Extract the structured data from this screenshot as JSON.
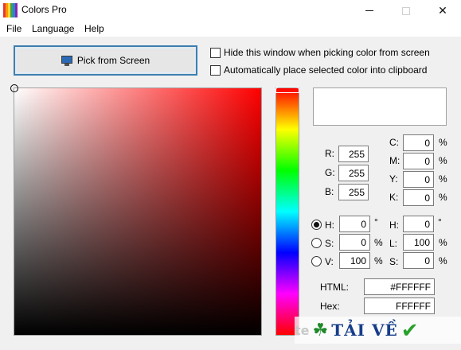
{
  "window": {
    "title": "Colors Pro",
    "icon": "color-bars-icon",
    "minimize_icon": "minimize-icon",
    "maximize_icon": "maximize-icon",
    "close_glyph": "✕"
  },
  "menu": {
    "items": [
      {
        "label": "File"
      },
      {
        "label": "Language"
      },
      {
        "label": "Help"
      }
    ]
  },
  "toolbar": {
    "pick_label": "Pick from Screen",
    "pick_icon": "monitor-icon"
  },
  "options": {
    "hide_window": {
      "label": "Hide this window when picking color from screen",
      "checked": false
    },
    "auto_clipboard": {
      "label": "Automatically place selected color into clipboard",
      "checked": false
    }
  },
  "picker": {
    "selected_color": "#FFFFFF",
    "hue_color": "#FF0000"
  },
  "rgb": {
    "r_label": "R:",
    "r_value": "255",
    "g_label": "G:",
    "g_value": "255",
    "b_label": "B:",
    "b_value": "255"
  },
  "cmyk": {
    "c_label": "C:",
    "c_value": "0",
    "m_label": "M:",
    "m_value": "0",
    "y_label": "Y:",
    "y_value": "0",
    "k_label": "K:",
    "k_value": "0",
    "unit": "%"
  },
  "hsv": {
    "h_label": "H:",
    "h_value": "0",
    "h_unit": "°",
    "s_label": "S:",
    "s_value": "0",
    "s_unit": "%",
    "v_label": "V:",
    "v_value": "100",
    "v_unit": "%",
    "selected": "H"
  },
  "hsl": {
    "h_label": "H:",
    "h_value": "0",
    "h_unit": "°",
    "l_label": "L:",
    "l_value": "100",
    "l_unit": "%",
    "s_label": "S:",
    "s_value": "0",
    "s_unit": "%"
  },
  "codes": {
    "html_label": "HTML:",
    "html_value": "#FFFFFF",
    "hex_label": "Hex:",
    "hex_value": "FFFFFF"
  },
  "watermark": {
    "prefix": "te",
    "text": "TẢI VỀ",
    "clover_glyph": "☘",
    "check_glyph": "✔"
  }
}
